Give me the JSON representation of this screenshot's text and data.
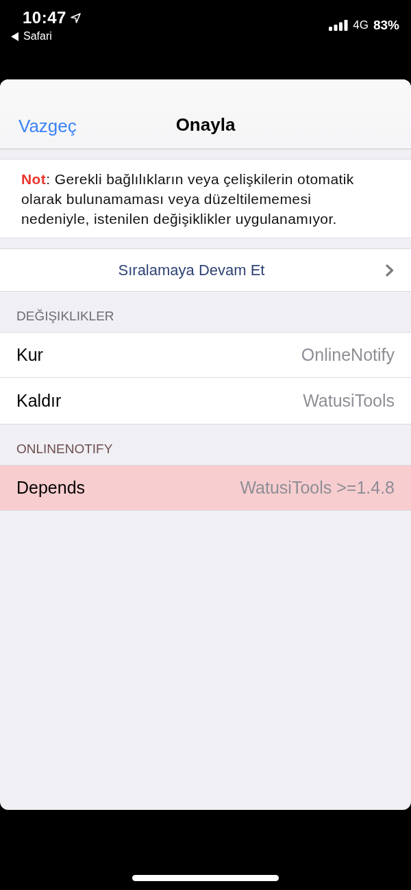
{
  "status_bar": {
    "time": "10:47",
    "back_label": "Safari",
    "network": "4G",
    "battery": "83%"
  },
  "nav": {
    "cancel": "Vazgeç",
    "title": "Onayla"
  },
  "note": {
    "text": "**Not**: Gerekli bağlılıkların veya çelişkilerin otomatik olarak bulunamaması veya düzeltilememesi nedeniyle, istenilen değişiklikler uygulanamıyor."
  },
  "continue_button": {
    "label": "Sıralamaya Devam Et"
  },
  "sections": [
    {
      "header": "DEĞIŞIKLIKLER",
      "kind": "changes",
      "rows": [
        {
          "label": "Kur",
          "value": "OnlineNotify",
          "highlighted": false
        },
        {
          "label": "Kaldır",
          "value": "WatusiTools",
          "highlighted": false
        }
      ]
    },
    {
      "header": "ONLINENOTIFY",
      "kind": "issue",
      "rows": [
        {
          "label": "Depends",
          "value": "WatusiTools >=1.4.8",
          "highlighted": true
        }
      ]
    }
  ]
}
